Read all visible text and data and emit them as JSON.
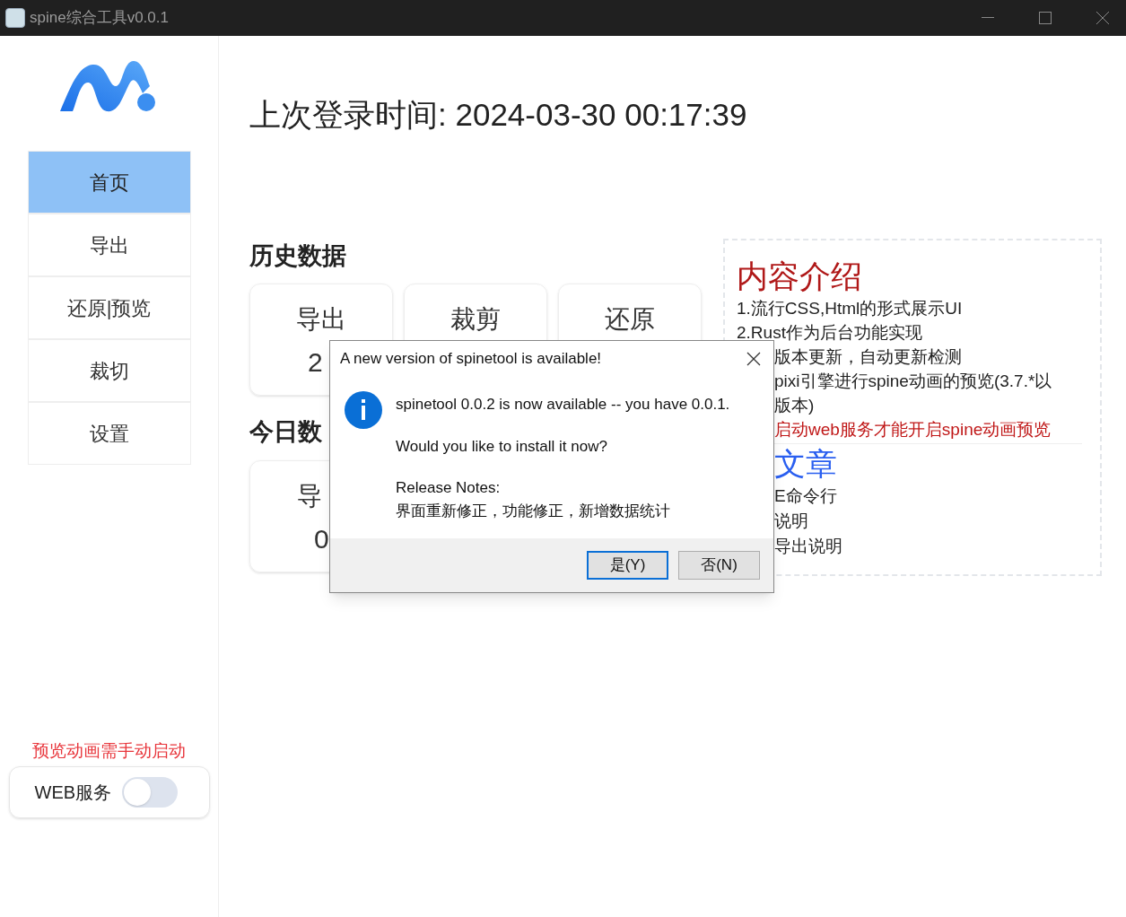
{
  "window": {
    "title": "spine综合工具v0.0.1"
  },
  "sidebar": {
    "items": [
      {
        "label": "首页",
        "selected": true
      },
      {
        "label": "导出",
        "selected": false
      },
      {
        "label": "还原|预览",
        "selected": false
      },
      {
        "label": "裁切",
        "selected": false
      },
      {
        "label": "设置",
        "selected": false
      }
    ],
    "notice": "预览动画需手动启动",
    "web_service": {
      "label": "WEB服务",
      "on": false
    }
  },
  "main": {
    "last_login": "上次登录时间: 2024-03-30 00:17:39",
    "history": {
      "title": "历史数据",
      "cards": [
        {
          "label": "导出",
          "value": "2"
        },
        {
          "label": "裁剪"
        },
        {
          "label": "还原"
        }
      ]
    },
    "today": {
      "title": "今日数",
      "cards": [
        {
          "label": "导",
          "value": "0"
        }
      ]
    }
  },
  "info_panel": {
    "title": "内容介绍",
    "lines": [
      {
        "text": "1.流行CSS,Html的形式展示UI",
        "kind": "plain"
      },
      {
        "text": "2.Rust作为后台功能实现",
        "kind": "plain"
      },
      {
        "text": "版本更新，自动更新检测",
        "kind": "plain",
        "covered": true
      },
      {
        "text": "pixi引擎进行spine动画的预览(3.7.*以",
        "kind": "plain",
        "covered": true
      },
      {
        "text": "版本)",
        "kind": "plain",
        "covered": true
      },
      {
        "text": "启动web服务才能开启spine动画预览",
        "kind": "warning",
        "covered": true
      }
    ],
    "articles_title": "文章",
    "articles": [
      "E命令行",
      "说明",
      "导出说明"
    ]
  },
  "dialog": {
    "title": "A new version of spinetool is available!",
    "message": "spinetool 0.0.2 is now available -- you have 0.0.1.",
    "question": "Would you like to install it now?",
    "notes_title": "Release Notes:",
    "notes": "界面重新修正，功能修正，新增数据统计",
    "buttons": [
      {
        "label": "是(Y)",
        "selected": true
      },
      {
        "label": "否(N)",
        "selected": false
      }
    ]
  }
}
